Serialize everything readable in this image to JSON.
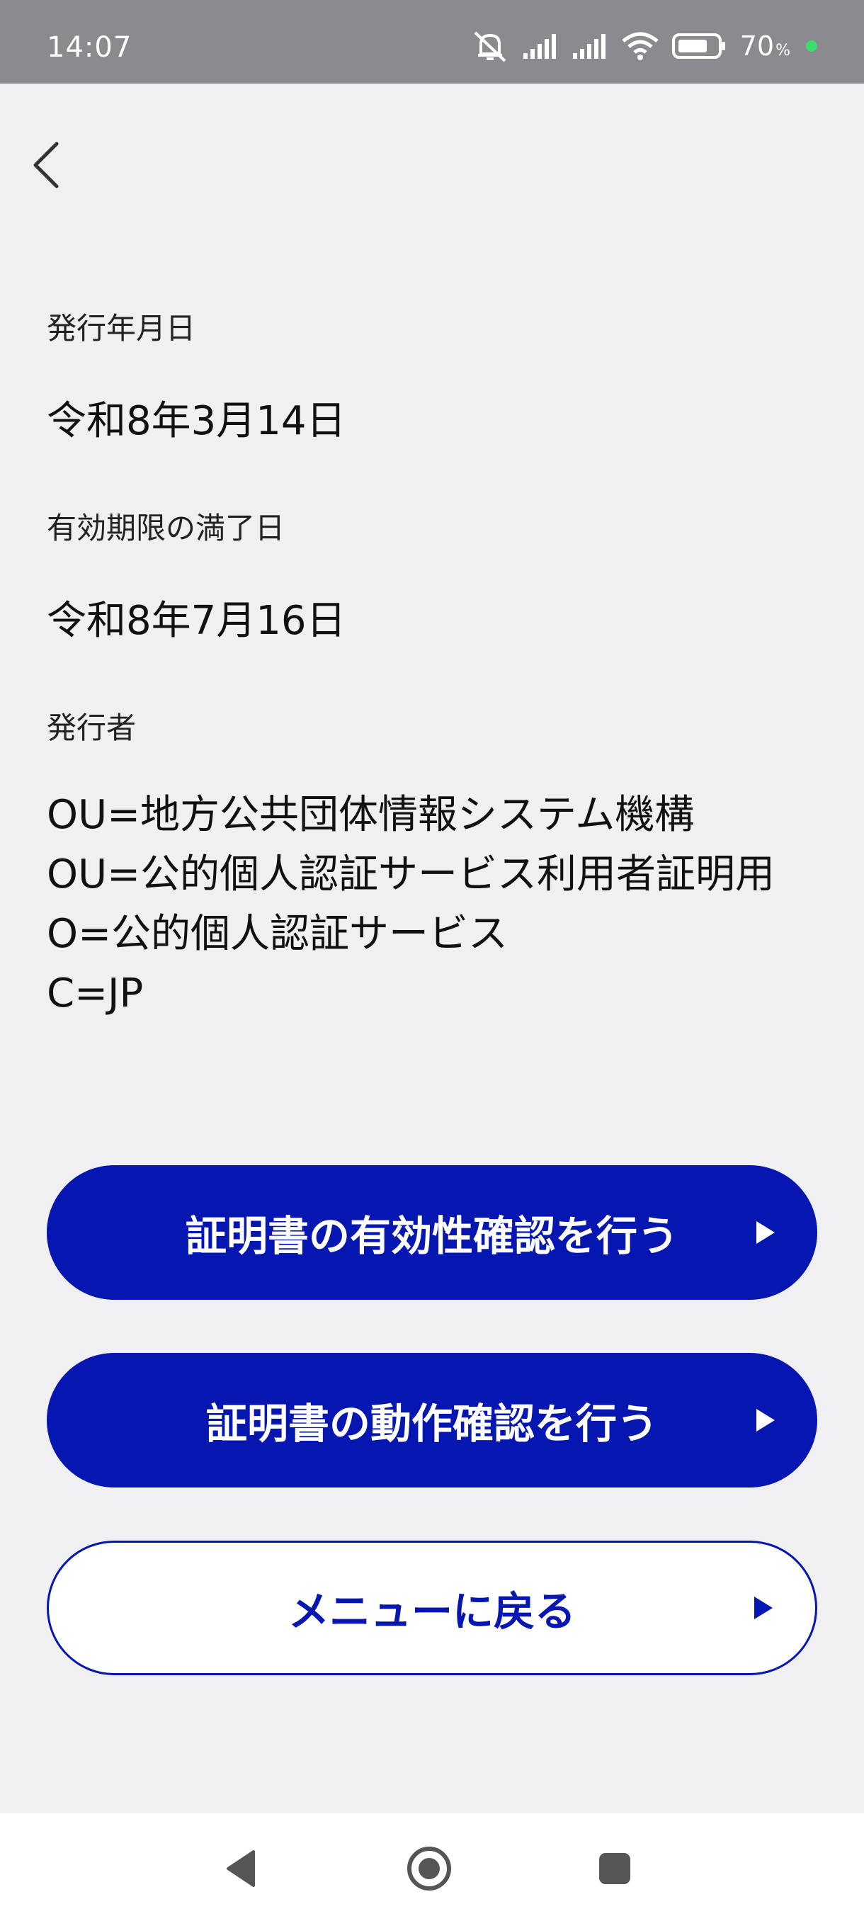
{
  "status_bar": {
    "time": "14:07",
    "battery_level": "70",
    "battery_unit": "%",
    "icons": [
      "mute-icon",
      "signal-icon",
      "signal-icon",
      "wifi-icon",
      "battery-icon",
      "charging-dot-icon"
    ]
  },
  "header": {
    "back_icon": "chevron-left-icon"
  },
  "fields": {
    "issue_date": {
      "label": "発行年月日",
      "value": "令和8年3月14日"
    },
    "expiry_date": {
      "label": "有効期限の満了日",
      "value": "令和8年7月16日"
    },
    "issuer": {
      "label": "発行者",
      "lines": [
        "OU=地方公共団体情報システム機構",
        "OU=公的個人認証サービス利用者証明用",
        "O=公的個人認証サービス",
        "C=JP"
      ]
    }
  },
  "buttons": {
    "validity_check": "証明書の有効性確認を行う",
    "operation_check": "証明書の動作確認を行う",
    "back_to_menu": "メニューに戻る"
  },
  "colors": {
    "primary": "#0616b0",
    "background": "#f0f0f2",
    "status_bar": "#8a8a8f"
  },
  "nav": {
    "icons": [
      "back-triangle-icon",
      "home-circle-icon",
      "recents-square-icon"
    ]
  }
}
